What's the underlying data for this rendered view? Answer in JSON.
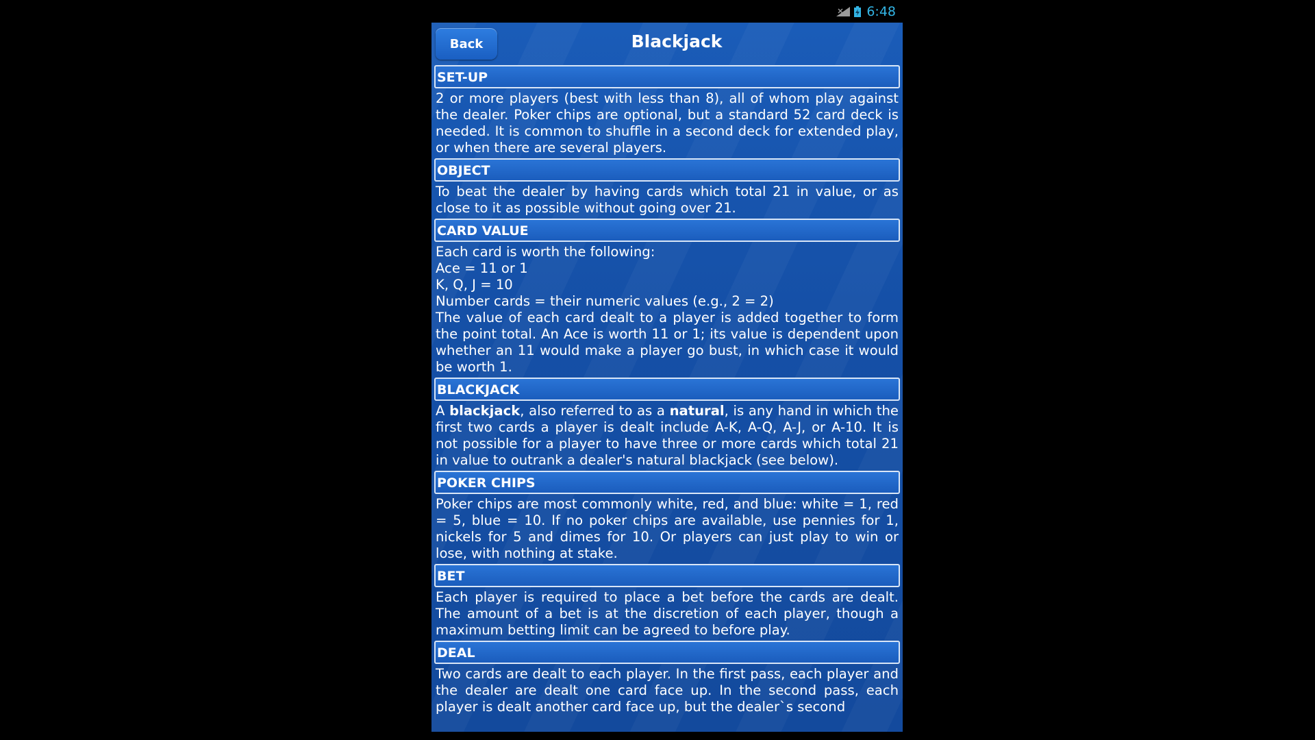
{
  "statusbar": {
    "time": "6:48",
    "signal_icon": "signal-icon",
    "battery_icon": "battery-icon"
  },
  "header": {
    "back_label": "Back",
    "title": "Blackjack"
  },
  "sections": {
    "setup": {
      "heading": "SET-UP",
      "body": "2 or more players (best with less than 8), all of whom play against the dealer. Poker chips are optional, but a standard 52 card deck is needed. It is common to shuffle in a second deck for extended play, or when there are several players."
    },
    "object": {
      "heading": "OBJECT",
      "body": "To beat the dealer by having cards which total 21 in value, or as close to it as possible without going over 21."
    },
    "card_value": {
      "heading": "CARD VALUE",
      "lines": [
        "Each card is worth the following:",
        "Ace = 11 or 1",
        "K, Q, J = 10",
        "Number cards = their numeric values (e.g., 2 = 2)"
      ],
      "body": "The value of each card dealt to a player is added together to form the point total. An Ace is worth 11 or 1; its value is dependent upon whether an 11 would make a player go bust, in which case it would be worth 1."
    },
    "blackjack": {
      "heading": "BLACKJACK",
      "body_pre": "A ",
      "term1": "blackjack",
      "body_mid": ", also referred to as a ",
      "term2": "natural",
      "body_post": ", is any hand in which the first two cards a player is dealt include A-K, A-Q, A-J, or A-10. It is not possible for a player to have three or more cards which total 21 in value to outrank a dealer's natural blackjack (see below)."
    },
    "poker_chips": {
      "heading": "POKER CHIPS",
      "body": "Poker chips are most commonly white, red, and blue: white = 1, red = 5, blue = 10. If no poker chips are available, use pennies for 1, nickels for 5 and dimes for 10. Or players can just play to win or lose, with nothing at stake."
    },
    "bet": {
      "heading": "BET",
      "body": "Each player is required to place a bet before the cards are dealt. The amount of a bet is at the discretion of each player, though a maximum betting limit can be agreed to before play."
    },
    "deal": {
      "heading": "DEAL",
      "body": "Two cards are dealt to each player. In the first pass, each player and the dealer are dealt one card face up. In the second pass, each player is dealt another card face up, but the dealer`s second"
    }
  }
}
